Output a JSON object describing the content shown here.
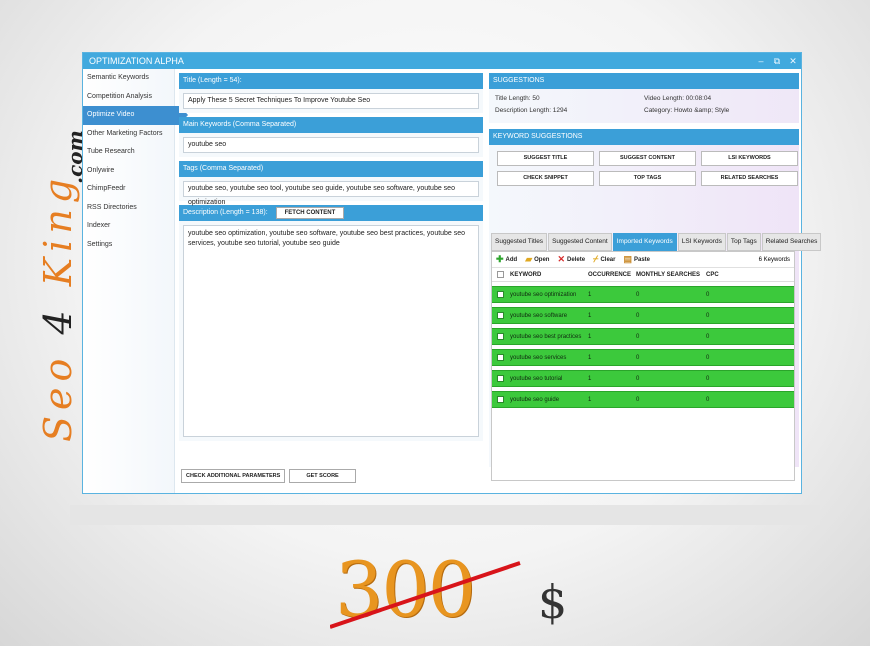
{
  "brand": {
    "seo": "Seo",
    "four": "4",
    "king": "King",
    "com": ".com"
  },
  "window": {
    "title": "OPTIMIZATION ALPHA",
    "controls": [
      "–",
      "⧉",
      "✕"
    ]
  },
  "sidebar": {
    "items": [
      {
        "label": "Semantic Keywords"
      },
      {
        "label": "Competition Analysis"
      },
      {
        "label": "Optimize Video"
      },
      {
        "label": "Other Marketing Factors"
      },
      {
        "label": "Tube Research"
      },
      {
        "label": "Onlywire"
      },
      {
        "label": "ChimpFeedr"
      },
      {
        "label": "RSS Directories"
      },
      {
        "label": "Indexer"
      },
      {
        "label": "Settings"
      }
    ]
  },
  "left": {
    "title_header": "Title (Length = 54):",
    "title_value": "Apply These 5 Secret Techniques To Improve Youtube Seo",
    "keywords_header": "Main Keywords (Comma Separated)",
    "keywords_value": "youtube seo",
    "tags_header": "Tags (Comma Separated)",
    "tags_value": "youtube seo, youtube seo tool, youtube seo guide, youtube seo software, youtube seo optimization",
    "description_header": "Description (Length = 138):",
    "fetch_button": "FETCH CONTENT",
    "description_value": "youtube seo optimization, youtube seo software, youtube seo best practices, youtube seo services, youtube seo tutorial, youtube seo guide",
    "check_button": "CHECK ADDITIONAL PARAMETERS",
    "score_button": "GET SCORE"
  },
  "suggestions": {
    "header": "SUGGESTIONS",
    "title_length": "Title Length: 50",
    "video_length": "Video Length: 00:08:04",
    "description_length": "Description Length: 1294",
    "category": "Category: Howto &amp; Style"
  },
  "keyword_suggestions": {
    "header": "KEYWORD SUGGESTIONS",
    "buttons": [
      "SUGGEST TITLE",
      "SUGGEST CONTENT",
      "LSI KEYWORDS",
      "CHECK SNIPPET",
      "TOP TAGS",
      "RELATED SEARCHES"
    ],
    "tabs": [
      "Suggested Titles",
      "Suggested Content",
      "Imported Keywords",
      "LSI Keywords",
      "Top Tags",
      "Related Searches"
    ],
    "active_tab": 2,
    "toolbar": {
      "add": "Add",
      "open": "Open",
      "delete": "Delete",
      "clear": "Clear",
      "paste": "Paste",
      "count": "6 Keywords"
    },
    "columns": [
      "KEYWORD",
      "OCCURRENCE",
      "MONTHLY SEARCHES",
      "CPC"
    ],
    "rows": [
      {
        "keyword": "youtube seo optimization",
        "occurrence": "1",
        "monthly": "0",
        "cpc": "0"
      },
      {
        "keyword": "youtube seo software",
        "occurrence": "1",
        "monthly": "0",
        "cpc": "0"
      },
      {
        "keyword": "youtube seo best practices",
        "occurrence": "1",
        "monthly": "0",
        "cpc": "0"
      },
      {
        "keyword": "youtube seo services",
        "occurrence": "1",
        "monthly": "0",
        "cpc": "0"
      },
      {
        "keyword": "youtube seo tutorial",
        "occurrence": "1",
        "monthly": "0",
        "cpc": "0"
      },
      {
        "keyword": "youtube seo guide",
        "occurrence": "1",
        "monthly": "0",
        "cpc": "0"
      }
    ]
  },
  "price": {
    "amount": "300",
    "currency": "$"
  },
  "colors": {
    "accent": "#3b9fd8",
    "row_green": "#3cc93c",
    "brand_orange": "#e67e22"
  }
}
